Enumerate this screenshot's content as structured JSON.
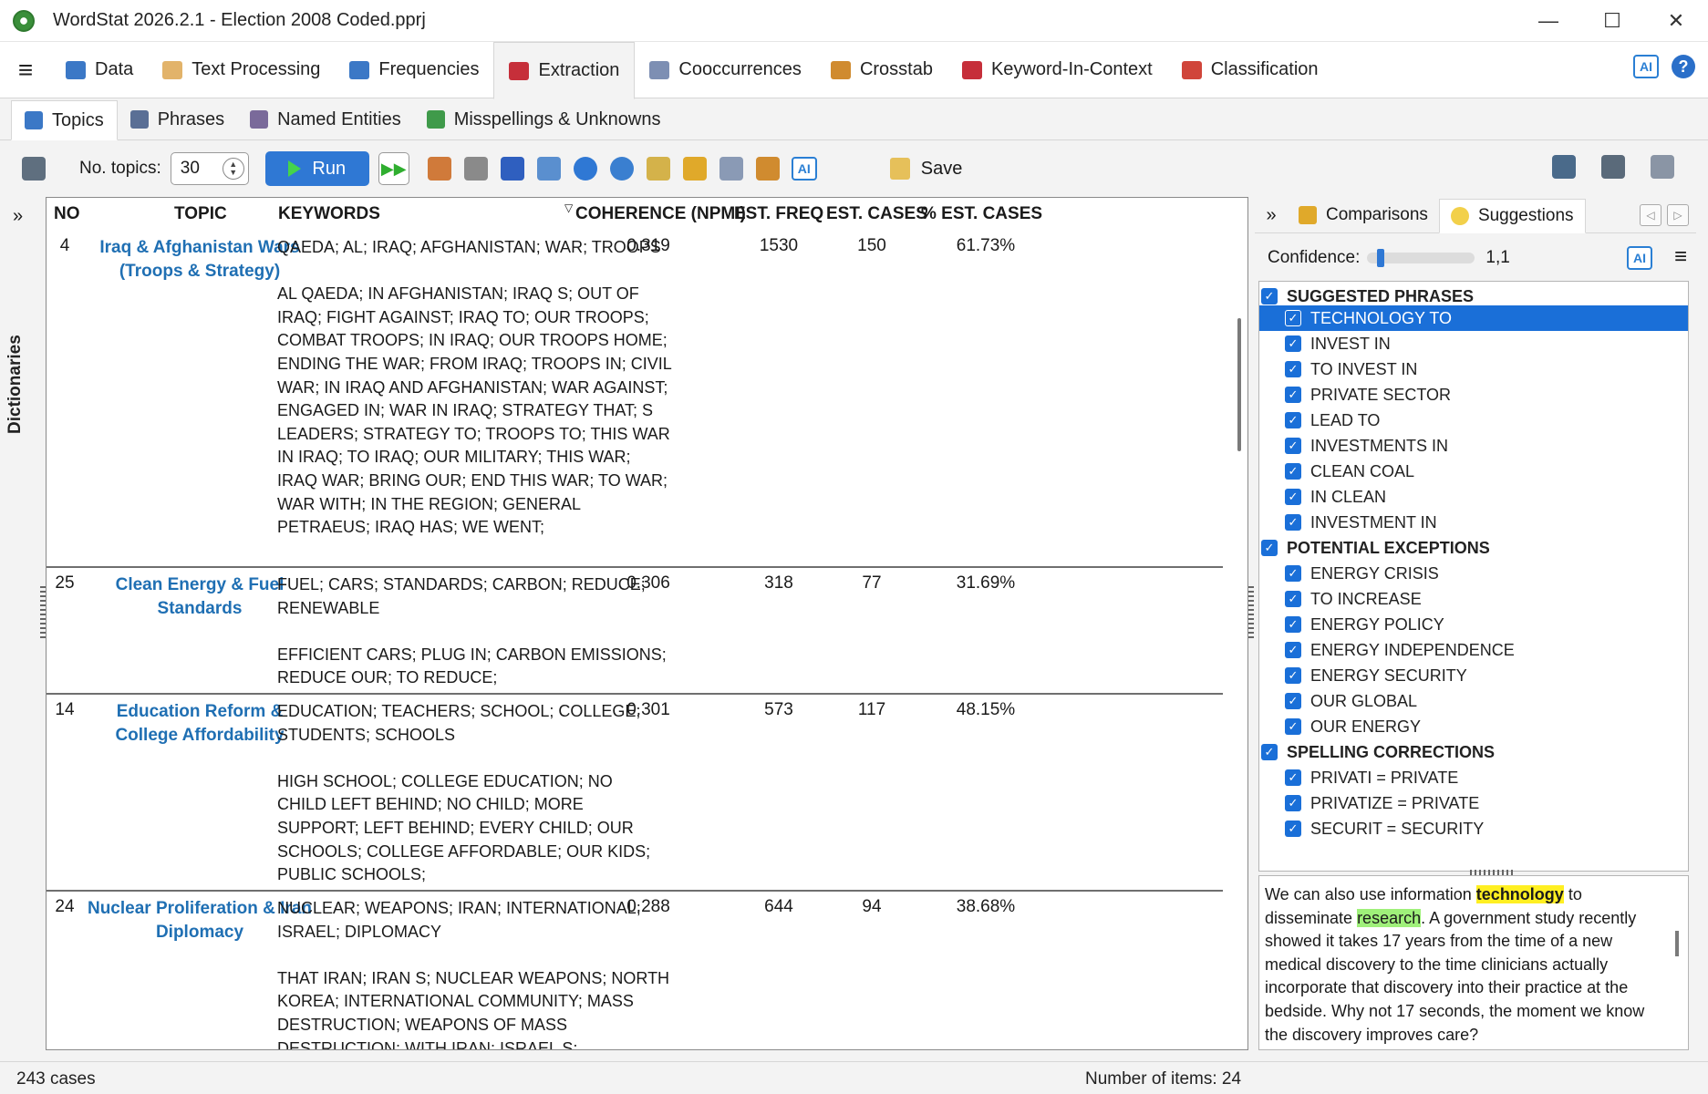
{
  "window": {
    "title": "WordStat 2026.2.1 - Election 2008 Coded.pprj",
    "minimize": "—",
    "maximize": "☐",
    "close": "✕"
  },
  "main_tabs": [
    {
      "label": "Data",
      "icon": "data-grid-icon",
      "color": "#3b78c6"
    },
    {
      "label": "Text Processing",
      "icon": "text-processing-icon",
      "color": "#e2b36a"
    },
    {
      "label": "Frequencies",
      "icon": "frequencies-icon",
      "color": "#3b78c6"
    },
    {
      "label": "Extraction",
      "icon": "extraction-icon",
      "color": "#c62f3a"
    },
    {
      "label": "Cooccurrences",
      "icon": "cooccurrences-icon",
      "color": "#7d8fb3"
    },
    {
      "label": "Crosstab",
      "icon": "crosstab-icon",
      "color": "#d08b2f"
    },
    {
      "label": "Keyword-In-Context",
      "icon": "kwic-icon",
      "color": "#c62f3a"
    },
    {
      "label": "Classification",
      "icon": "classification-icon",
      "color": "#d0453a"
    }
  ],
  "main_active": "Extraction",
  "header_right": {
    "ai_label": "AI",
    "help_label": "?"
  },
  "sub_tabs": [
    {
      "label": "Topics",
      "icon": "topics-tree-icon"
    },
    {
      "label": "Phrases",
      "icon": "phrases-icon"
    },
    {
      "label": "Named Entities",
      "icon": "named-entities-icon"
    },
    {
      "label": "Misspellings & Unknowns",
      "icon": "spelling-check-icon"
    }
  ],
  "sub_active": "Topics",
  "toolbar": {
    "ntopics_label": "No. topics:",
    "ntopics_value": "30",
    "run_label": "Run",
    "save_label": "Save",
    "ai_label": "AI"
  },
  "left_strip": {
    "label": "Dictionaries",
    "chevron": "»"
  },
  "table": {
    "columns": [
      "NO",
      "TOPIC",
      "KEYWORDS",
      "COHERENCE (NPMI)",
      "EST. FREQ",
      "EST. CASES",
      "% EST. CASES"
    ],
    "rows": [
      {
        "no": "4",
        "topic": "Iraq & Afghanistan Wars (Troops & Strategy)",
        "keywords_primary": "QAEDA; AL; IRAQ; AFGHANISTAN; WAR; TROOPS",
        "keywords_phrases": "AL QAEDA; IN AFGHANISTAN; IRAQ S; OUT OF IRAQ; FIGHT AGAINST; IRAQ TO; OUR TROOPS; COMBAT TROOPS; IN IRAQ; OUR TROOPS HOME; ENDING THE WAR; FROM IRAQ; TROOPS IN; CIVIL WAR; IN IRAQ AND AFGHANISTAN; WAR AGAINST; ENGAGED IN; WAR IN IRAQ; STRATEGY THAT; S LEADERS; STRATEGY TO; TROOPS TO; THIS WAR IN IRAQ; TO IRAQ; OUR MILITARY; THIS WAR; IRAQ WAR; BRING OUR; END THIS WAR; TO WAR; WAR WITH; IN THE REGION; GENERAL PETRAEUS; IRAQ HAS; WE WENT;",
        "coherence": "0.319",
        "freq": "1530",
        "cases": "150",
        "pct": "61.73%"
      },
      {
        "no": "25",
        "topic": "Clean Energy & Fuel Standards",
        "keywords_primary": "FUEL; CARS; STANDARDS; CARBON; REDUCE; RENEWABLE",
        "keywords_phrases": "EFFICIENT CARS; PLUG IN; CARBON EMISSIONS; REDUCE OUR; TO REDUCE;",
        "coherence": "0.306",
        "freq": "318",
        "cases": "77",
        "pct": "31.69%"
      },
      {
        "no": "14",
        "topic": "Education Reform & College Affordability",
        "keywords_primary": "EDUCATION; TEACHERS; SCHOOL; COLLEGE; STUDENTS; SCHOOLS",
        "keywords_phrases": "HIGH SCHOOL; COLLEGE EDUCATION; NO CHILD LEFT BEHIND; NO CHILD; MORE SUPPORT; LEFT BEHIND; EVERY CHILD; OUR SCHOOLS; COLLEGE AFFORDABLE; OUR KIDS; PUBLIC SCHOOLS;",
        "coherence": "0.301",
        "freq": "573",
        "cases": "117",
        "pct": "48.15%"
      },
      {
        "no": "24",
        "topic": "Nuclear Proliferation & Iran Diplomacy",
        "keywords_primary": "NUCLEAR; WEAPONS; IRAN; INTERNATIONAL; ISRAEL; DIPLOMACY",
        "keywords_phrases": "THAT IRAN; IRAN S; NUCLEAR WEAPONS; NORTH KOREA; INTERNATIONAL COMMUNITY; MASS DESTRUCTION; WEAPONS OF MASS DESTRUCTION; WITH IRAN; ISRAEL S;",
        "coherence": "0.288",
        "freq": "644",
        "cases": "94",
        "pct": "38.68%"
      }
    ]
  },
  "right_panel": {
    "chevron": "»",
    "tabs": [
      {
        "label": "Comparisons",
        "icon": "comparisons-chart-icon"
      },
      {
        "label": "Suggestions",
        "icon": "lightbulb-icon"
      }
    ],
    "active_tab": "Suggestions",
    "confidence_label": "Confidence:",
    "confidence_value": "1,1",
    "confidence_level": 0.1,
    "ai_label": "AI",
    "groups": [
      {
        "label": "SUGGESTED PHRASES",
        "items": [
          "TECHNOLOGY TO",
          "INVEST IN",
          "TO INVEST IN",
          "PRIVATE SECTOR",
          "LEAD TO",
          "INVESTMENTS IN",
          "CLEAN COAL",
          "IN CLEAN",
          "INVESTMENT IN"
        ]
      },
      {
        "label": "POTENTIAL EXCEPTIONS",
        "items": [
          "ENERGY CRISIS",
          "TO INCREASE",
          "ENERGY POLICY",
          "ENERGY INDEPENDENCE",
          "ENERGY SECURITY",
          "OUR GLOBAL",
          "OUR ENERGY"
        ]
      },
      {
        "label": "SPELLING CORRECTIONS",
        "items": [
          "PRIVATI = PRIVATE",
          "PRIVATIZE = PRIVATE",
          "SECURIT = SECURITY"
        ]
      }
    ],
    "selected_item": "TECHNOLOGY TO",
    "preview": {
      "before": "We can also use information ",
      "highlight1": "technology",
      "between": " to disseminate ",
      "highlight2": "research",
      "after": ". A government study recently showed it takes 17 years from the time of a new medical discovery to the time clinicians actually incorporate that discovery into their practice at the bedside. Why not 17 seconds, the moment we know the discovery improves care?"
    }
  },
  "status": {
    "cases": "243 cases",
    "items": "Number of items: 24"
  }
}
